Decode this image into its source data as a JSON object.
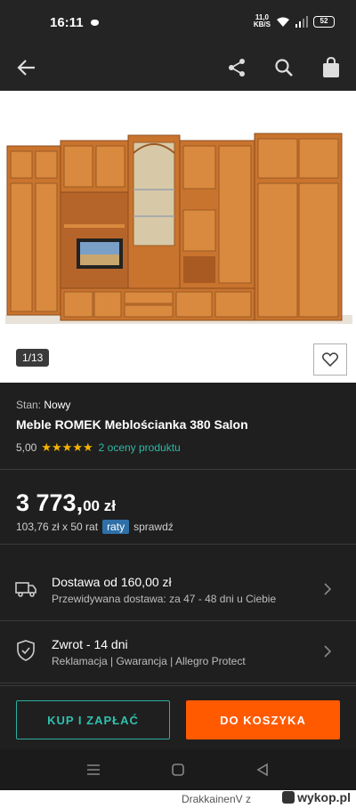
{
  "status_bar": {
    "time": "16:11",
    "net_speed_value": "11,0",
    "net_speed_unit": "KB/S",
    "battery": "52"
  },
  "app_bar": {
    "back_icon": "arrow-left-icon",
    "share_icon": "share-icon",
    "search_icon": "search-icon",
    "cart_icon": "shopping-bag-icon"
  },
  "gallery": {
    "counter": "1/13",
    "favorite_icon": "heart-icon"
  },
  "product": {
    "condition_label": "Stan:",
    "condition_value": "Nowy",
    "title": "Meble ROMEK Meblościanka 380 Salon",
    "rating_value": "5,00",
    "stars": "★★★★★",
    "rating_count_text": "2 oceny produktu"
  },
  "price": {
    "main": "3 773,",
    "fraction": "00 zł",
    "installment_text": "103,76 zł x 50 rat",
    "installment_badge": "raty",
    "installment_link": "sprawdź"
  },
  "rows": [
    {
      "icon": "truck-icon",
      "title": "Dostawa od 160,00 zł",
      "subtitle": "Przewidywana dostawa: za 47 - 48 dni u Ciebie"
    },
    {
      "icon": "shield-check-icon",
      "title": "Zwrot - 14 dni",
      "subtitle": "Reklamacja | Gwarancja | Allegro Protect"
    }
  ],
  "actions": {
    "buy_now": "KUP I ZAPŁAĆ",
    "add_to_cart": "DO KOSZYKA"
  },
  "colors": {
    "accent_teal": "#30c0ae",
    "primary_orange": "#ff5a00",
    "star": "#f5b400",
    "badge_blue": "#2f6fa8"
  },
  "watermark": {
    "author": "DrakkainenV  z",
    "site": "wykop.pl"
  }
}
